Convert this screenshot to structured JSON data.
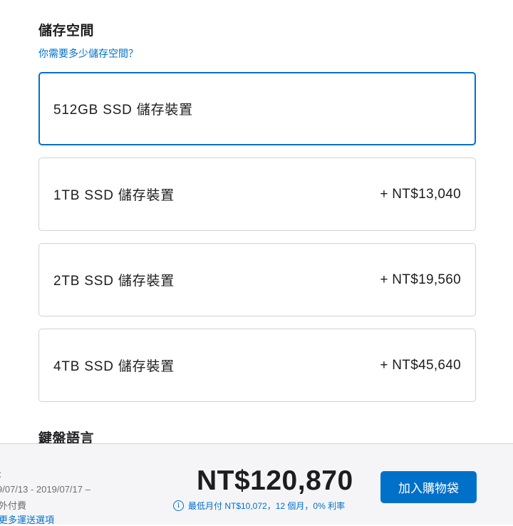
{
  "storage": {
    "title": "儲存空間",
    "help_link": "你需要多少儲存空間？",
    "options": [
      {
        "label": "512GB SSD 儲存裝置",
        "price": ""
      },
      {
        "label": "1TB SSD 儲存裝置",
        "price": "+ NT$13,040"
      },
      {
        "label": "2TB SSD 儲存裝置",
        "price": "+ NT$19,560"
      },
      {
        "label": "4TB SSD 儲存裝置",
        "price": "+ NT$45,640"
      }
    ],
    "selected_index": 0
  },
  "keyboard": {
    "title": "鍵盤語言"
  },
  "footer": {
    "shipping_prefix": ":",
    "shipping_dates": "9/07/13 - 2019/07/17 –",
    "shipping_fee": "外付費",
    "shipping_more": "更多運送選項",
    "total": "NT$120,870",
    "monthly": "最低月付 NT$10,072，12 個月，0% 利率",
    "info_icon": "info-icon",
    "add_to_bag": "加入購物袋"
  },
  "colors": {
    "accent": "#0070c9",
    "text": "#1d1d1f",
    "border": "#d2d2d7",
    "footer_bg": "#f5f5f7"
  }
}
